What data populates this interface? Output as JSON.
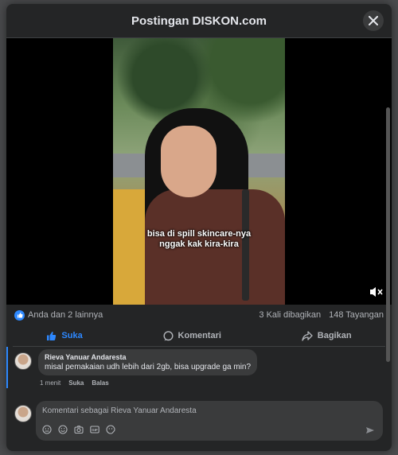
{
  "modal": {
    "title": "Postingan DISKON.com"
  },
  "video": {
    "caption_line1": "bisa di spill skincare-nya",
    "caption_line2": "nggak kak kira-kira"
  },
  "stats": {
    "reactions": "Anda dan 2 lainnya",
    "shares": "3 Kali dibagikan",
    "views": "148 Tayangan"
  },
  "actions": {
    "like": "Suka",
    "comment": "Komentari",
    "share": "Bagikan"
  },
  "comment": {
    "author": "Rieva Yanuar Andaresta",
    "text": "misal pemakaian udh lebih dari 2gb, bisa upgrade ga min?",
    "time": "1 menit",
    "like": "Suka",
    "reply": "Balas"
  },
  "composer": {
    "placeholder": "Komentari sebagai Rieva Yanuar Andaresta"
  },
  "colors": {
    "accent": "#2d88ff",
    "surface": "#242526"
  }
}
